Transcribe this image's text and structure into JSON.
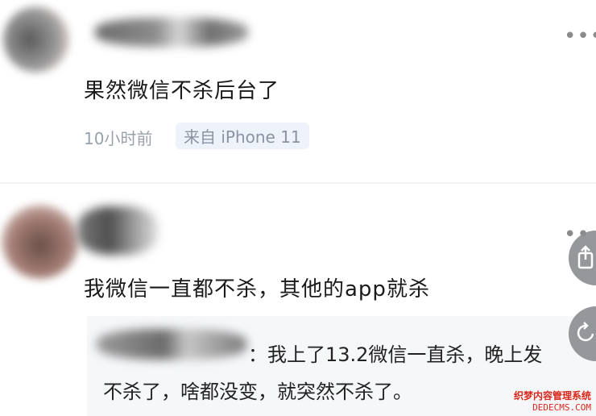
{
  "posts": [
    {
      "body": "果然微信不杀后台了",
      "time": "10小时前",
      "source": "来自 iPhone 11",
      "more_icon": "more-dots-icon"
    },
    {
      "body": "我微信一直都不杀，其他的app就杀",
      "more_icon": "more-dots-icon",
      "reply": {
        "line1": "：我上了13.2微信一直杀，晚上发",
        "line2": "不杀了，啥都没变，就突然不杀了。"
      }
    }
  ],
  "watermark": {
    "cn": "织梦内容管理系统",
    "en": "DEDECMS.COM"
  }
}
